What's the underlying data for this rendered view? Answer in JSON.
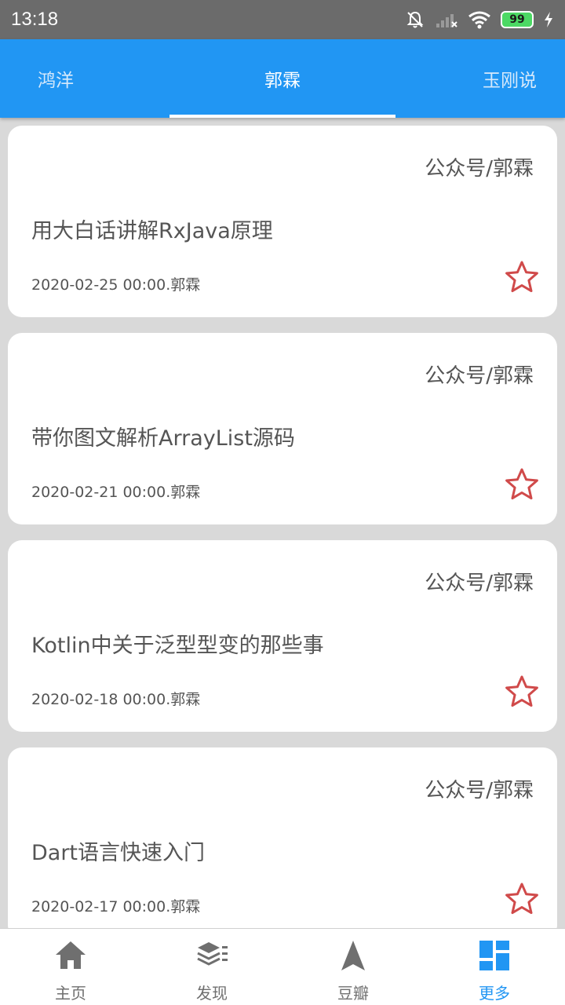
{
  "status_bar": {
    "time": "13:18",
    "battery": "99",
    "icons": [
      "bell-off-icon",
      "signal-icon",
      "wifi-icon",
      "battery-icon",
      "charging-icon"
    ]
  },
  "tabs": [
    {
      "label": "鸿洋",
      "active": false
    },
    {
      "label": "郭霖",
      "active": true
    },
    {
      "label": "玉刚说",
      "active": false
    }
  ],
  "articles": [
    {
      "source": "公众号/郭霖",
      "title": "用大白话讲解RxJava原理",
      "meta": "2020-02-25 00:00.郭霖",
      "starred": false
    },
    {
      "source": "公众号/郭霖",
      "title": "带你图文解析ArrayList源码",
      "meta": "2020-02-21 00:00.郭霖",
      "starred": false
    },
    {
      "source": "公众号/郭霖",
      "title": "Kotlin中关于泛型型变的那些事",
      "meta": "2020-02-18 00:00.郭霖",
      "starred": false
    },
    {
      "source": "公众号/郭霖",
      "title": "Dart语言快速入门",
      "meta": "2020-02-17 00:00.郭霖",
      "starred": false
    }
  ],
  "bottom_nav": [
    {
      "label": "主页",
      "icon": "home-icon",
      "active": false
    },
    {
      "label": "发现",
      "icon": "layers-icon",
      "active": false
    },
    {
      "label": "豆瓣",
      "icon": "navigation-arrow-icon",
      "active": false
    },
    {
      "label": "更多",
      "icon": "dashboard-icon",
      "active": true
    }
  ],
  "colors": {
    "primary": "#2196f3",
    "status_bar": "#6b6b6b",
    "star": "#d04a4a",
    "background": "#d9d9d9"
  }
}
